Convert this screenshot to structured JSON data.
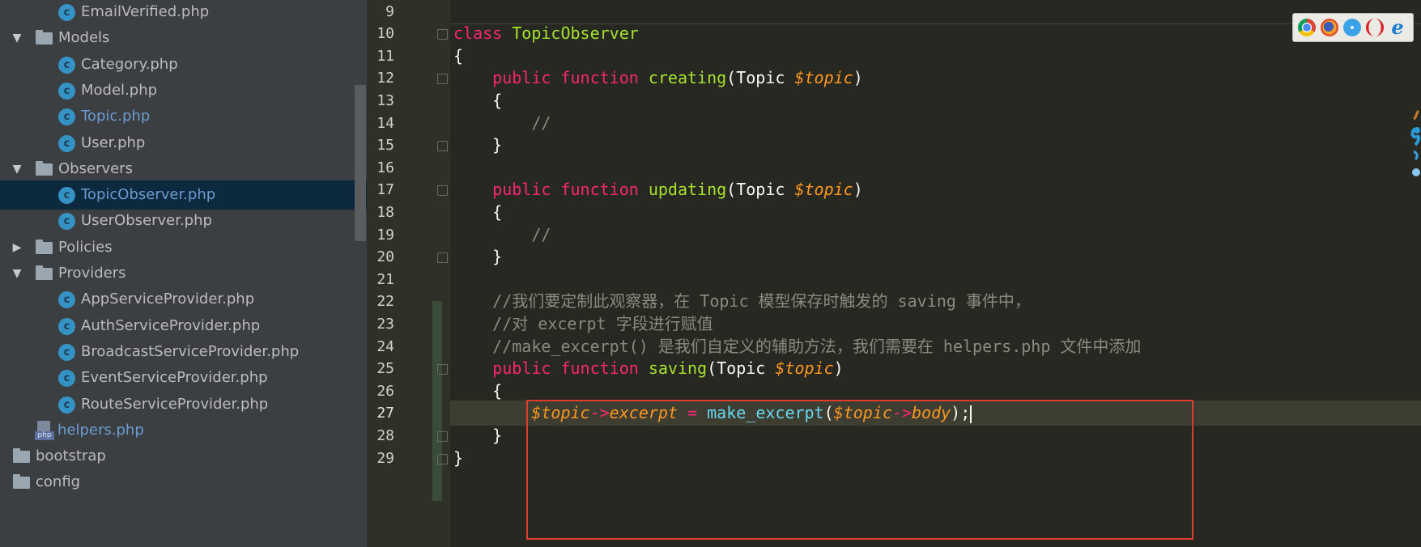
{
  "sidebar": {
    "items": [
      {
        "kind": "class",
        "indent": 2,
        "label": "EmailVerified.php",
        "style": "normal"
      },
      {
        "kind": "folder",
        "indent": 1,
        "expanded": true,
        "label": "Models"
      },
      {
        "kind": "class",
        "indent": 2,
        "label": "Category.php",
        "style": "normal"
      },
      {
        "kind": "class",
        "indent": 2,
        "label": "Model.php",
        "style": "normal"
      },
      {
        "kind": "class",
        "indent": 2,
        "label": "Topic.php",
        "style": "modified"
      },
      {
        "kind": "class",
        "indent": 2,
        "label": "User.php",
        "style": "normal"
      },
      {
        "kind": "folder",
        "indent": 1,
        "expanded": true,
        "label": "Observers"
      },
      {
        "kind": "class",
        "indent": 2,
        "label": "TopicObserver.php",
        "style": "selected"
      },
      {
        "kind": "class",
        "indent": 2,
        "label": "UserObserver.php",
        "style": "normal"
      },
      {
        "kind": "folder",
        "indent": 1,
        "expanded": false,
        "label": "Policies"
      },
      {
        "kind": "folder",
        "indent": 1,
        "expanded": true,
        "label": "Providers"
      },
      {
        "kind": "class",
        "indent": 2,
        "label": "AppServiceProvider.php",
        "style": "normal"
      },
      {
        "kind": "class",
        "indent": 2,
        "label": "AuthServiceProvider.php",
        "style": "normal"
      },
      {
        "kind": "class",
        "indent": 2,
        "label": "BroadcastServiceProvider.php",
        "style": "normal"
      },
      {
        "kind": "class",
        "indent": 2,
        "label": "EventServiceProvider.php",
        "style": "normal"
      },
      {
        "kind": "class",
        "indent": 2,
        "label": "RouteServiceProvider.php",
        "style": "normal"
      },
      {
        "kind": "php",
        "indent": 1,
        "label": "helpers.php",
        "style": "modified"
      },
      {
        "kind": "folder",
        "indent": 0,
        "expanded": null,
        "label": "bootstrap"
      },
      {
        "kind": "folder",
        "indent": 0,
        "expanded": null,
        "label": "config"
      }
    ]
  },
  "editor": {
    "current_line": 27,
    "lines": [
      {
        "n": 9,
        "tokens": []
      },
      {
        "n": 10,
        "tokens": [
          {
            "t": "kw",
            "v": "class"
          },
          {
            "t": "wh",
            "v": " "
          },
          {
            "t": "fn",
            "v": "TopicObserver"
          }
        ]
      },
      {
        "n": 11,
        "tokens": [
          {
            "t": "wh",
            "v": "{"
          }
        ]
      },
      {
        "n": 12,
        "tokens": [
          {
            "t": "wh",
            "v": "    "
          },
          {
            "t": "kw",
            "v": "public"
          },
          {
            "t": "wh",
            "v": " "
          },
          {
            "t": "kw",
            "v": "function"
          },
          {
            "t": "wh",
            "v": " "
          },
          {
            "t": "fn",
            "v": "creating"
          },
          {
            "t": "wh",
            "v": "(Topic "
          },
          {
            "t": "var",
            "v": "$topic"
          },
          {
            "t": "wh",
            "v": ")"
          }
        ]
      },
      {
        "n": 13,
        "tokens": [
          {
            "t": "wh",
            "v": "    {"
          }
        ]
      },
      {
        "n": 14,
        "tokens": [
          {
            "t": "wh",
            "v": "        "
          },
          {
            "t": "cm",
            "v": "//"
          }
        ]
      },
      {
        "n": 15,
        "tokens": [
          {
            "t": "wh",
            "v": "    }"
          }
        ]
      },
      {
        "n": 16,
        "tokens": []
      },
      {
        "n": 17,
        "tokens": [
          {
            "t": "wh",
            "v": "    "
          },
          {
            "t": "kw",
            "v": "public"
          },
          {
            "t": "wh",
            "v": " "
          },
          {
            "t": "kw",
            "v": "function"
          },
          {
            "t": "wh",
            "v": " "
          },
          {
            "t": "fn",
            "v": "updating"
          },
          {
            "t": "wh",
            "v": "(Topic "
          },
          {
            "t": "var",
            "v": "$topic"
          },
          {
            "t": "wh",
            "v": ")"
          }
        ]
      },
      {
        "n": 18,
        "tokens": [
          {
            "t": "wh",
            "v": "    {"
          }
        ]
      },
      {
        "n": 19,
        "tokens": [
          {
            "t": "wh",
            "v": "        "
          },
          {
            "t": "cm",
            "v": "//"
          }
        ]
      },
      {
        "n": 20,
        "tokens": [
          {
            "t": "wh",
            "v": "    }"
          }
        ]
      },
      {
        "n": 21,
        "tokens": []
      },
      {
        "n": 22,
        "tokens": [
          {
            "t": "wh",
            "v": "    "
          },
          {
            "t": "cm",
            "v": "//我们要定制此观察器，在 Topic 模型保存时触发的 saving 事件中，"
          }
        ]
      },
      {
        "n": 23,
        "tokens": [
          {
            "t": "wh",
            "v": "    "
          },
          {
            "t": "cm",
            "v": "//对 excerpt 字段进行赋值"
          }
        ]
      },
      {
        "n": 24,
        "tokens": [
          {
            "t": "wh",
            "v": "    "
          },
          {
            "t": "cm",
            "v": "//make_excerpt() 是我们自定义的辅助方法，我们需要在 helpers.php 文件中添加"
          }
        ]
      },
      {
        "n": 25,
        "tokens": [
          {
            "t": "wh",
            "v": "    "
          },
          {
            "t": "kw",
            "v": "public"
          },
          {
            "t": "wh",
            "v": " "
          },
          {
            "t": "kw",
            "v": "function"
          },
          {
            "t": "wh",
            "v": " "
          },
          {
            "t": "fn",
            "v": "saving"
          },
          {
            "t": "wh",
            "v": "(Topic "
          },
          {
            "t": "var",
            "v": "$topic"
          },
          {
            "t": "wh",
            "v": ")"
          }
        ]
      },
      {
        "n": 26,
        "tokens": [
          {
            "t": "wh",
            "v": "    {"
          }
        ]
      },
      {
        "n": 27,
        "tokens": [
          {
            "t": "wh",
            "v": "        "
          },
          {
            "t": "var",
            "v": "$topic"
          },
          {
            "t": "op",
            "v": "->"
          },
          {
            "t": "var",
            "v": "excerpt"
          },
          {
            "t": "wh",
            "v": " "
          },
          {
            "t": "op",
            "v": "="
          },
          {
            "t": "wh",
            "v": " "
          },
          {
            "t": "call",
            "v": "make_excerpt"
          },
          {
            "t": "wh",
            "v": "("
          },
          {
            "t": "var",
            "v": "$topic"
          },
          {
            "t": "op",
            "v": "->"
          },
          {
            "t": "var",
            "v": "body"
          },
          {
            "t": "wh",
            "v": ");"
          },
          {
            "t": "caret",
            "v": ""
          }
        ]
      },
      {
        "n": 28,
        "tokens": [
          {
            "t": "wh",
            "v": "    }"
          }
        ]
      },
      {
        "n": 29,
        "tokens": [
          {
            "t": "wh",
            "v": "}"
          }
        ]
      }
    ],
    "fold_markers": [
      {
        "line": 10,
        "type": "open"
      },
      {
        "line": 12,
        "type": "open"
      },
      {
        "line": 15,
        "type": "close"
      },
      {
        "line": 17,
        "type": "open"
      },
      {
        "line": 20,
        "type": "close"
      },
      {
        "line": 25,
        "type": "open"
      },
      {
        "line": 28,
        "type": "close"
      },
      {
        "line": 29,
        "type": "close"
      }
    ]
  },
  "browser_icons": [
    "chrome-icon",
    "firefox-icon",
    "safari-icon",
    "opera-icon",
    "ie-icon"
  ],
  "colors": {
    "keyword": "#f92672",
    "function": "#a6e22e",
    "variable": "#fd971f",
    "call": "#66d9ef",
    "comment": "#8a8a80",
    "highlight_box": "#e33b2e"
  }
}
